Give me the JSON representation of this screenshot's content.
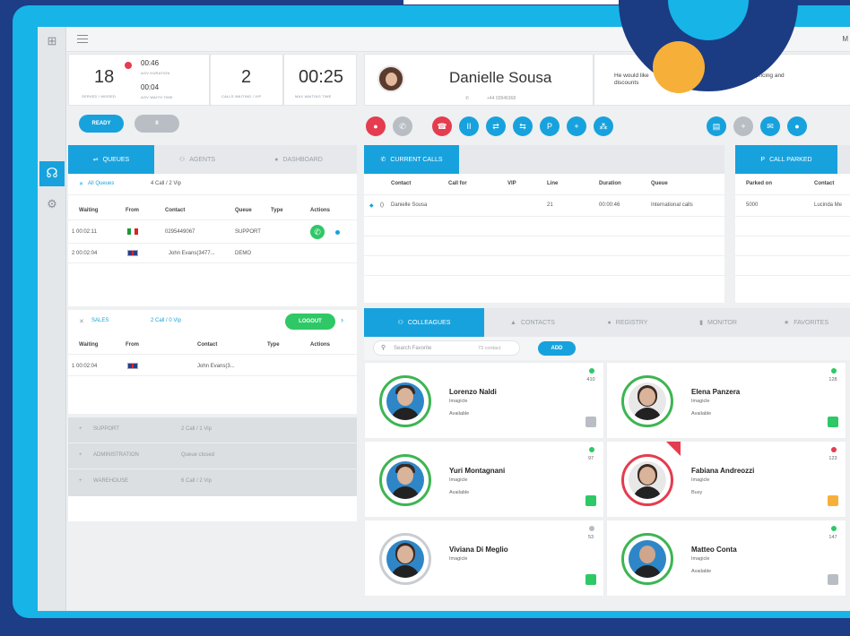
{
  "topbar": {
    "menu_icon": "hamburger-icon",
    "right_text": "M"
  },
  "rail": {
    "icons": [
      "grid-icon",
      "headset-icon",
      "settings-icon"
    ]
  },
  "stats": {
    "waiting_count": "18",
    "waiting_label": "SERVED / MISSED",
    "avg_duration_value": "00:46",
    "avg_duration_label": "AGV DURATION",
    "avg_wait_value": "00:04",
    "avg_wait_label": "AGV WAITH TIME",
    "calls_waiting_value": "2",
    "calls_waiting_label": "CALLS WAITING / VIP",
    "max_wait_value": "00:25",
    "max_wait_label": "MAX WAITING TIME"
  },
  "agent_controls": {
    "ready_label": "READY",
    "pause_label": "II"
  },
  "caller": {
    "name": "Danielle Sousa",
    "phone": "+44 02846368",
    "note": "He would like info regarding pricing and discounts",
    "note_part1": "He would like",
    "note_part2": "discounts",
    "note_part3": "arding pricing and"
  },
  "left_tabs": [
    {
      "label": "QUEUES",
      "icon": "shuffle-icon"
    },
    {
      "label": "AGENTS",
      "icon": "users-icon"
    },
    {
      "label": "DASHBOARD",
      "icon": "info-icon"
    }
  ],
  "queues": {
    "filter_label": "All Queues",
    "filter_count": "4 Call / 2 Vip",
    "columns": [
      "Waiting",
      "From",
      "Contact",
      "Queue",
      "Type",
      "Actions"
    ],
    "rows": [
      {
        "waiting": "1 00:02:11",
        "flag": "it",
        "contact": "0295449067",
        "queue": "SUPPORT"
      },
      {
        "waiting": "2 00:02:04",
        "flag": "uk",
        "contact": "John Evans(3477...",
        "queue": "DEMO"
      }
    ]
  },
  "sales": {
    "label": "SALES",
    "count": "2 Call / 0 Vip",
    "logout_label": "LOGOUT",
    "columns": [
      "Waiting",
      "From",
      "Contact",
      "Type",
      "Actions"
    ],
    "rows": [
      {
        "waiting": "1 00:02:04",
        "flag": "uk",
        "contact": "John Evans(3..."
      }
    ]
  },
  "other_queues": [
    {
      "name": "SUPPORT",
      "info": "2 Call / 1 Vip"
    },
    {
      "name": "ADMINISTRATION",
      "info": "Queue closed"
    },
    {
      "name": "WAREHOUSE",
      "info": "6 Call / 2 Vip"
    }
  ],
  "current_calls": {
    "tab_label": "CURRENT CALLS",
    "columns": [
      "Contact",
      "Call for",
      "VIP",
      "Line",
      "Duration",
      "Queue"
    ],
    "rows": [
      {
        "contact": "Danielle Sousa",
        "line": "21",
        "duration": "00:00:46",
        "queue": "International calls"
      }
    ]
  },
  "call_parked": {
    "tab_label": "CALL PARKED",
    "columns": [
      "Parked on",
      "Contact"
    ],
    "rows": [
      {
        "parked_on": "5000",
        "contact": "Lucinda Me"
      }
    ]
  },
  "bottom_tabs": [
    {
      "label": "COLLEAGUES",
      "icon": "users-icon"
    },
    {
      "label": "CONTACTS",
      "icon": "user-icon"
    },
    {
      "label": "REGISTRY",
      "icon": "clock-icon"
    },
    {
      "label": "MONITOR",
      "icon": "bars-icon"
    },
    {
      "label": "FAVORITES",
      "icon": "star-icon"
    }
  ],
  "favorites_search": {
    "placeholder": "Search Favorite",
    "count": "73 contact",
    "add_label": "ADD"
  },
  "colleagues": [
    {
      "name": "Lorenzo Naldi",
      "org": "Imagicle",
      "status": "Available",
      "ext": "410",
      "dot": "#2ec866"
    },
    {
      "name": "Elena Panzera",
      "org": "Imagicle",
      "status": "Available",
      "ext": "128",
      "dot": "#2ec866"
    },
    {
      "name": "Yuri Montagnani",
      "org": "Imagicle",
      "status": "Available",
      "ext": "97",
      "dot": "#2ec866"
    },
    {
      "name": "Fabiana Andreozzi",
      "org": "Imagicle",
      "status": "Busy",
      "ext": "123",
      "dot": "#e53c4f"
    },
    {
      "name": "Viviana Di Meglio",
      "org": "Imagicle",
      "status": "",
      "ext": "53",
      "dot": "#b7bcc2"
    },
    {
      "name": "Matteo Conta",
      "org": "Imagicle",
      "status": "Available",
      "ext": "147",
      "dot": "#2ec866"
    }
  ],
  "colors": {
    "accent": "#17a2dd",
    "green": "#2ec866",
    "red": "#e53c4f",
    "frame": "#17b4e8",
    "navy": "#1b3c82",
    "orange": "#f6b03a"
  }
}
